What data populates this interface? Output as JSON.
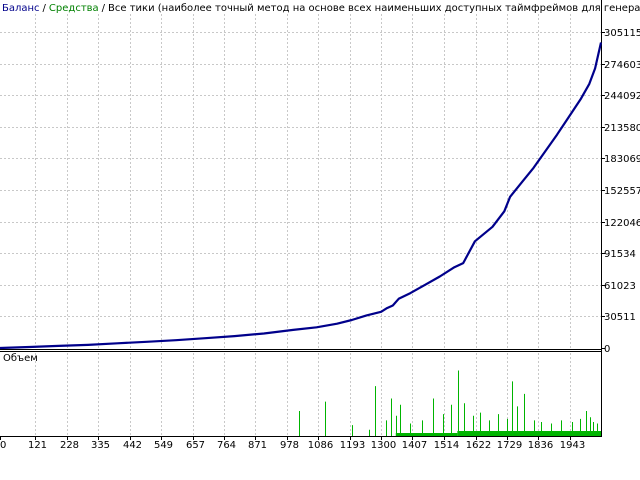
{
  "legend": {
    "balance": "Баланс",
    "sep1": "/",
    "equity": "Средства",
    "sep2": "/",
    "mode": "Все тики (наиболее точный метод на основе всех наименьших доступных таймфреймов для генерации каждого тика"
  },
  "colors": {
    "balance": "#00008b",
    "equity": "#008000",
    "volume": "#00b400",
    "grid": "#c8c8c8",
    "axis": "#000000",
    "background": "#ffffff"
  },
  "volume_label": "Объем",
  "chart_data": [
    {
      "type": "line",
      "series": [
        {
          "name": "Баланс",
          "x": [
            0,
            100,
            200,
            300,
            400,
            500,
            600,
            700,
            800,
            900,
            1000,
            1080,
            1150,
            1200,
            1250,
            1300,
            1320,
            1340,
            1360,
            1400,
            1450,
            1500,
            1550,
            1580,
            1620,
            1680,
            1720,
            1740,
            1780,
            1820,
            1860,
            1900,
            1940,
            1980,
            2010,
            2030,
            2050
          ],
          "y": [
            0,
            1000,
            2000,
            3000,
            4500,
            6000,
            7500,
            9500,
            11500,
            14000,
            17500,
            20000,
            23500,
            27000,
            31500,
            35000,
            38500,
            41000,
            47500,
            53000,
            61000,
            69000,
            78000,
            82000,
            103000,
            117000,
            132000,
            146000,
            160000,
            174000,
            190000,
            206000,
            223000,
            240000,
            255000,
            270000,
            295000
          ]
        }
      ],
      "xlim": [
        0,
        2050
      ],
      "ylim": [
        0,
        305115
      ],
      "y_ticks": [
        "0",
        "30511",
        "61023",
        "91534",
        "122046",
        "152557",
        "183069",
        "213580",
        "244092",
        "274603",
        "305115"
      ],
      "grid": true
    },
    {
      "type": "bar",
      "title": "Объем",
      "x_ticks": [
        "0",
        "121",
        "228",
        "335",
        "442",
        "549",
        "657",
        "764",
        "871",
        "978",
        "1086",
        "1193",
        "1300",
        "1407",
        "1514",
        "1622",
        "1729",
        "1836",
        "1943"
      ],
      "x_tick_values": [
        0,
        121,
        228,
        335,
        442,
        549,
        657,
        764,
        871,
        978,
        1086,
        1193,
        1300,
        1407,
        1514,
        1622,
        1729,
        1836,
        1943
      ],
      "xlim": [
        0,
        2050
      ],
      "ylim": [
        0,
        50
      ],
      "bars": [
        {
          "x": 1020,
          "value": 16
        },
        {
          "x": 1108,
          "value": 22
        },
        {
          "x": 1200,
          "value": 7
        },
        {
          "x": 1258,
          "value": 4
        },
        {
          "x": 1280,
          "value": 32
        },
        {
          "x": 1318,
          "value": 10
        },
        {
          "x": 1334,
          "value": 24
        },
        {
          "x": 1350,
          "value": 13
        },
        {
          "x": 1366,
          "value": 20
        },
        {
          "x": 1400,
          "value": 8
        },
        {
          "x": 1440,
          "value": 10
        },
        {
          "x": 1478,
          "value": 24
        },
        {
          "x": 1512,
          "value": 14
        },
        {
          "x": 1540,
          "value": 20
        },
        {
          "x": 1562,
          "value": 42
        },
        {
          "x": 1582,
          "value": 21
        },
        {
          "x": 1612,
          "value": 13
        },
        {
          "x": 1638,
          "value": 15
        },
        {
          "x": 1668,
          "value": 10
        },
        {
          "x": 1700,
          "value": 14
        },
        {
          "x": 1730,
          "value": 11
        },
        {
          "x": 1746,
          "value": 35
        },
        {
          "x": 1762,
          "value": 19
        },
        {
          "x": 1786,
          "value": 27
        },
        {
          "x": 1820,
          "value": 10
        },
        {
          "x": 1846,
          "value": 9
        },
        {
          "x": 1880,
          "value": 8
        },
        {
          "x": 1912,
          "value": 10
        },
        {
          "x": 1950,
          "value": 9
        },
        {
          "x": 1978,
          "value": 11
        },
        {
          "x": 1998,
          "value": 16
        },
        {
          "x": 2012,
          "value": 12
        },
        {
          "x": 2024,
          "value": 9
        },
        {
          "x": 2036,
          "value": 8
        }
      ]
    }
  ]
}
